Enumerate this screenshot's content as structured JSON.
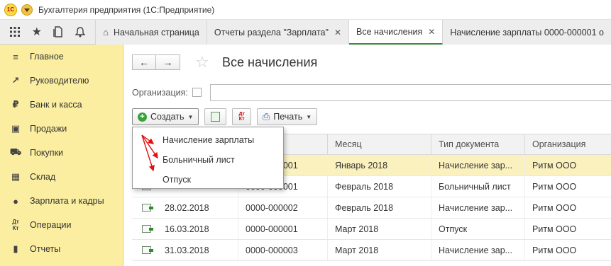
{
  "titlebar": {
    "logo_text": "1С",
    "title": "Бухгалтерия предприятия  (1С:Предприятие)"
  },
  "toolbar_icons": [
    "apps-grid-icon",
    "star-icon",
    "history-icon",
    "bell-icon"
  ],
  "tabs": [
    {
      "label": "Начальная страница",
      "icon": "home-icon",
      "closable": false,
      "active": false
    },
    {
      "label": "Отчеты раздела \"Зарплата\"",
      "closable": true,
      "active": false
    },
    {
      "label": "Все начисления",
      "closable": true,
      "active": true
    },
    {
      "label": "Начисление зарплаты 0000-000001 о",
      "closable": false,
      "active": false
    }
  ],
  "sidebar": {
    "items": [
      {
        "label": "Главное",
        "icon": "menu-lines-icon"
      },
      {
        "label": "Руководителю",
        "icon": "trend-icon"
      },
      {
        "label": "Банк и касса",
        "icon": "ruble-coin-icon"
      },
      {
        "label": "Продажи",
        "icon": "bag-icon"
      },
      {
        "label": "Покупки",
        "icon": "cart-icon"
      },
      {
        "label": "Склад",
        "icon": "warehouse-icon"
      },
      {
        "label": "Зарплата и кадры",
        "icon": "person-icon"
      },
      {
        "label": "Операции",
        "icon": "dt-kt-icon"
      },
      {
        "label": "Отчеты",
        "icon": "bar-chart-icon"
      }
    ]
  },
  "page": {
    "title": "Все начисления",
    "org_label": "Организация:",
    "org_value": ""
  },
  "commands": {
    "create_label": "Создать",
    "dtkt_top": "Дт",
    "dtkt_bottom": "Кт",
    "print_label": "Печать"
  },
  "create_menu": {
    "items": [
      "Начисление зарплаты",
      "Больничный лист",
      "Отпуск"
    ]
  },
  "table": {
    "columns": [
      "",
      "",
      "Месяц",
      "Тип документа",
      "Организация"
    ],
    "rows": [
      {
        "date": "",
        "number": "0000-000001",
        "month": "Январь 2018",
        "type": "Начисление зар...",
        "org": "Ритм ООО",
        "selected": true
      },
      {
        "date": "",
        "number": "0000-000001",
        "month": "Февраль 2018",
        "type": "Больничный лист",
        "org": "Ритм ООО",
        "selected": false
      },
      {
        "date": "28.02.2018",
        "number": "0000-000002",
        "month": "Февраль 2018",
        "type": "Начисление зар...",
        "org": "Ритм ООО",
        "selected": false
      },
      {
        "date": "16.03.2018",
        "number": "0000-000001",
        "month": "Март 2018",
        "type": "Отпуск",
        "org": "Ритм ООО",
        "selected": false
      },
      {
        "date": "31.03.2018",
        "number": "0000-000003",
        "month": "Март 2018",
        "type": "Начисление зар...",
        "org": "Ритм ООО",
        "selected": false
      }
    ]
  },
  "colors": {
    "sidebar_bg": "#fbeea0",
    "selected_row": "#fbf1bf",
    "create_plus": "#38a33a",
    "arrow_red": "#e01010",
    "active_tab_underline": "#3b8a3e"
  }
}
